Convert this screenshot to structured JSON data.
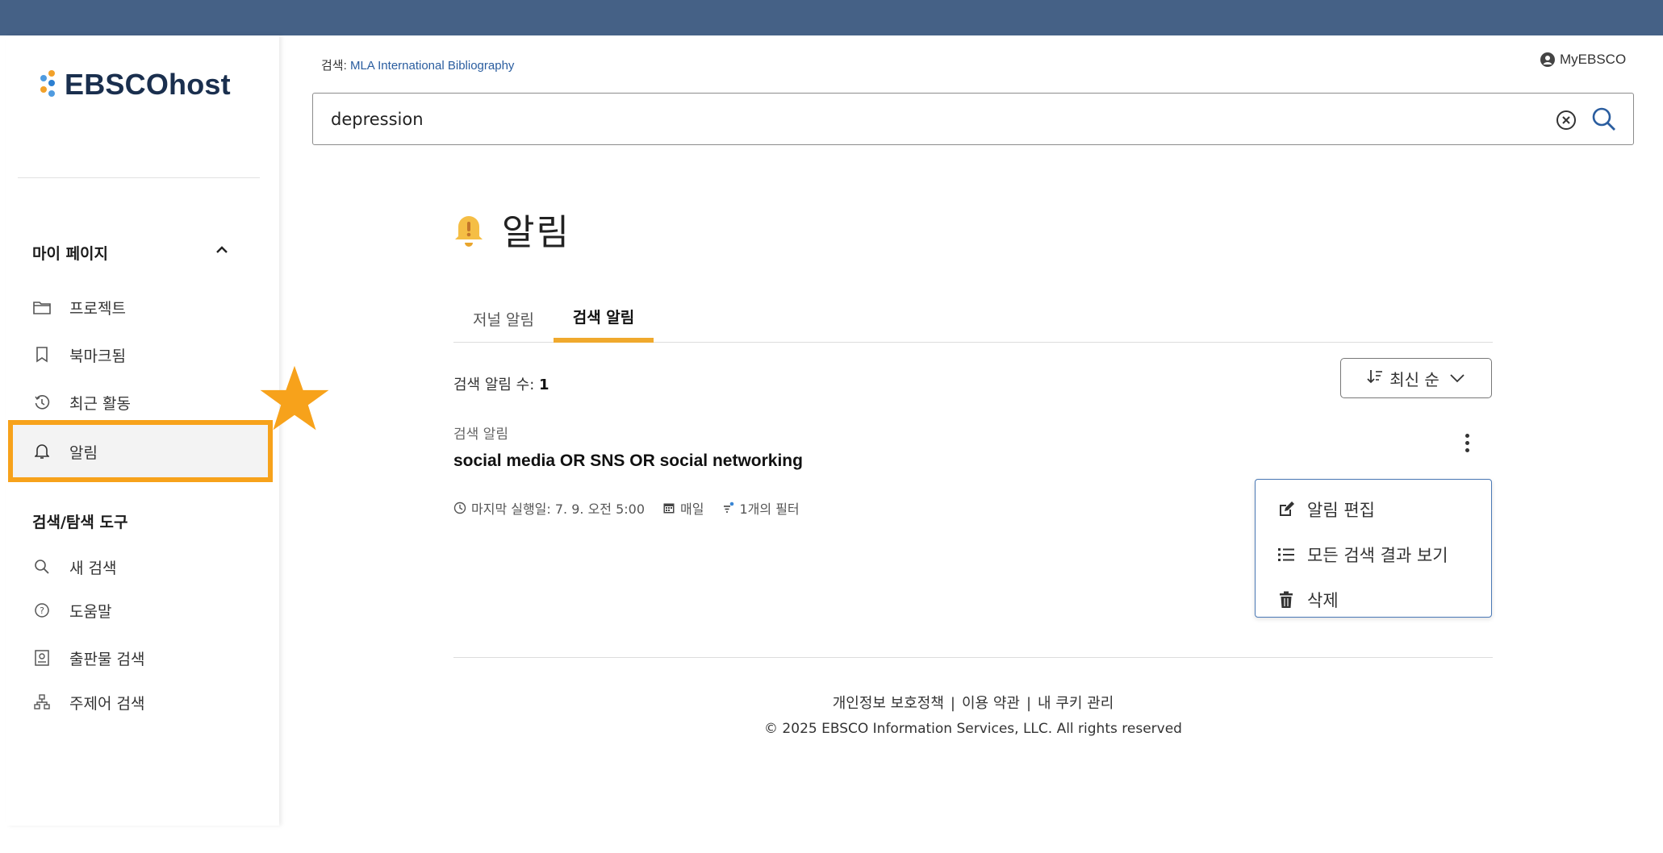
{
  "brand": {
    "logo_text": "EBSCOhost"
  },
  "header": {
    "search_scope_label": "검색:",
    "search_scope_db": "MLA International Bibliography",
    "account_label": "MyEBSCO",
    "search_value": "depression"
  },
  "sidebar": {
    "section1_title": "마이 페이지",
    "section1_items": [
      {
        "label": "프로젝트",
        "icon": "folder-icon"
      },
      {
        "label": "북마크됨",
        "icon": "bookmark-icon"
      },
      {
        "label": "최근 활동",
        "icon": "history-icon"
      },
      {
        "label": "알림",
        "icon": "bell-icon"
      }
    ],
    "section2_title": "검색/탐색 도구",
    "section2_items": [
      {
        "label": "새 검색",
        "icon": "search-icon"
      },
      {
        "label": "도움말",
        "icon": "help-icon"
      },
      {
        "label": "출판물 검색",
        "icon": "publication-icon"
      },
      {
        "label": "주제어 검색",
        "icon": "subject-tree-icon"
      }
    ]
  },
  "annotation_colors": {
    "highlight": "#f7a21b",
    "star": "#f7a21b"
  },
  "main": {
    "title": "알림",
    "tabs": [
      {
        "label": "저널 알림",
        "active": false
      },
      {
        "label": "검색 알림",
        "active": true
      }
    ],
    "count_label": "검색 알림 수:",
    "count_value": "1",
    "sort_label": "최신 순",
    "alert": {
      "type_label": "검색 알림",
      "query": "social media OR SNS OR social networking",
      "last_run": "마지막 실행일: 7. 9. 오전 5:00",
      "frequency": "매일",
      "filters": "1개의 필터"
    },
    "menu": [
      {
        "label": "알림 편집",
        "icon": "edit-icon"
      },
      {
        "label": "모든 검색 결과 보기",
        "icon": "list-icon"
      },
      {
        "label": "삭제",
        "icon": "trash-icon"
      }
    ]
  },
  "footer": {
    "links": [
      "개인정보 보호정책",
      "이용 약관",
      "내 쿠키 관리"
    ],
    "copyright": "© 2025 EBSCO Information Services, LLC. All rights reserved"
  }
}
